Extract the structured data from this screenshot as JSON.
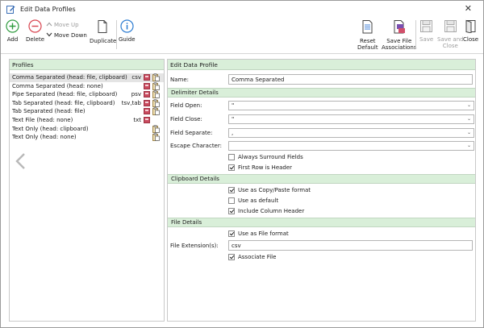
{
  "window": {
    "title": "Edit Data Profiles",
    "close_glyph": "✕"
  },
  "toolbar": {
    "add": "Add",
    "delete": "Delete",
    "move_up": "Move Up",
    "move_down": "Move Down",
    "duplicate": "Duplicate",
    "guide": "Guide",
    "reset_default_line1": "Reset",
    "reset_default_line2": "Default",
    "save_assoc_line1": "Save File",
    "save_assoc_line2": "Associations",
    "save": "Save",
    "save_close_line1": "Save and",
    "save_close_line2": "Close",
    "close": "Close"
  },
  "profiles": {
    "header": "Profiles",
    "items": [
      {
        "name": "Comma Separated (head: file, clipboard)",
        "ext": "csv",
        "file": true,
        "clip": true
      },
      {
        "name": "Comma Separated (head: none)",
        "ext": "",
        "file": true,
        "clip": true
      },
      {
        "name": "Pipe Separated (head: file, clipboard)",
        "ext": "psv",
        "file": true,
        "clip": true
      },
      {
        "name": "Tab Separated (head: file, clipboard)",
        "ext": "tsv,tab",
        "file": true,
        "clip": true
      },
      {
        "name": "Tab Separated (head: file)",
        "ext": "",
        "file": true,
        "clip": true
      },
      {
        "name": "Text File (head: none)",
        "ext": "txt",
        "file": true,
        "clip": false
      },
      {
        "name": "Text Only (head: clipboard)",
        "ext": "",
        "file": false,
        "clip": true
      },
      {
        "name": "Text Only (head: none)",
        "ext": "",
        "file": false,
        "clip": true
      }
    ]
  },
  "edit": {
    "header": "Edit Data Profile",
    "name_label": "Name:",
    "name_value": "Comma Separated",
    "delimiter": {
      "header": "Delimiter Details",
      "field_open_label": "Field Open:",
      "field_open_value": "\"",
      "field_close_label": "Field Close:",
      "field_close_value": "\"",
      "field_separate_label": "Field Separate:",
      "field_separate_value": ",",
      "escape_label": "Escape Character:",
      "escape_value": "",
      "always_surround": "Always Surround Fields",
      "always_surround_checked": false,
      "first_row_header": "First Row is Header",
      "first_row_header_checked": true
    },
    "clipboard": {
      "header": "Clipboard Details",
      "use_copy_paste": "Use as Copy/Paste format",
      "use_copy_paste_checked": true,
      "use_default": "Use as default",
      "use_default_checked": false,
      "include_header": "Include Column Header",
      "include_header_checked": true
    },
    "file": {
      "header": "File Details",
      "use_file_format": "Use as File format",
      "use_file_format_checked": true,
      "ext_label": "File Extension(s):",
      "ext_value": "csv",
      "associate": "Associate File",
      "associate_checked": true
    }
  },
  "colors": {
    "panel_header": "#d9efd9",
    "add_green": "#2f9b3e",
    "delete_red": "#d8434e",
    "guide_blue": "#2a7bd1",
    "disabled_gray": "#9d9d9d"
  }
}
